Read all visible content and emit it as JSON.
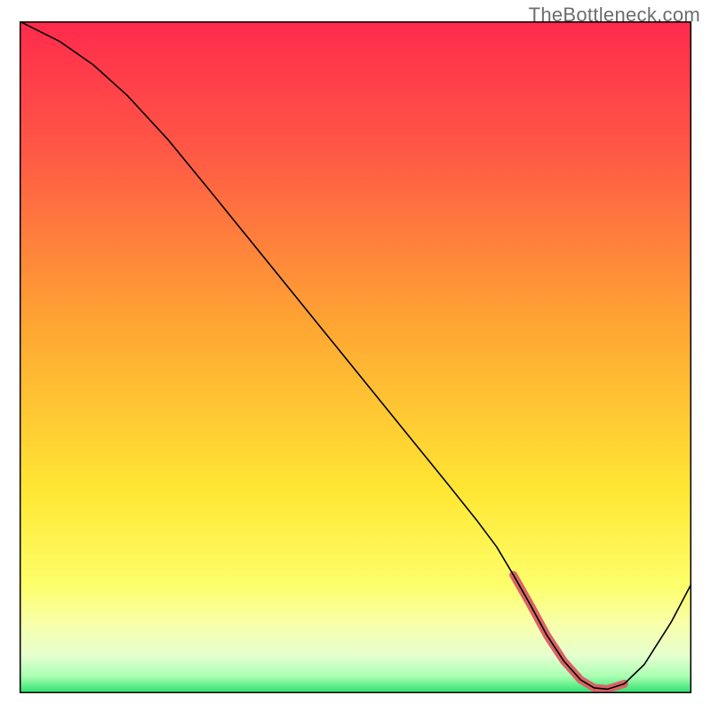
{
  "watermark": "TheBottleneck.com",
  "chart_data": {
    "type": "line",
    "title": "",
    "xlabel": "",
    "ylabel": "",
    "xlim": [
      0,
      100
    ],
    "ylim": [
      0,
      100
    ],
    "grid": false,
    "legend": false,
    "background_gradient": [
      {
        "pos": 0.0,
        "color": "#ff2a4d"
      },
      {
        "pos": 0.2,
        "color": "#ff5a45"
      },
      {
        "pos": 0.45,
        "color": "#ffa533"
      },
      {
        "pos": 0.7,
        "color": "#ffe733"
      },
      {
        "pos": 0.84,
        "color": "#fdff6b"
      },
      {
        "pos": 0.9,
        "color": "#f7ffad"
      },
      {
        "pos": 0.945,
        "color": "#e5ffcf"
      },
      {
        "pos": 0.975,
        "color": "#a9ffb2"
      },
      {
        "pos": 1.0,
        "color": "#27e06b"
      }
    ],
    "series": [
      {
        "name": "bottleneck-curve",
        "color": "#000000",
        "stroke_width": 1.6,
        "x": [
          0,
          6,
          11,
          16,
          22,
          28,
          34,
          40,
          46,
          52,
          58,
          64,
          68,
          71,
          73.5,
          76,
          78.5,
          81,
          83.5,
          85.5,
          87.5,
          90,
          93,
          97,
          100
        ],
        "y": [
          100,
          97,
          93.5,
          89,
          82.5,
          75.2,
          67.8,
          60.4,
          53,
          45.6,
          38.2,
          30.8,
          25.8,
          21.8,
          17.6,
          13.2,
          8.6,
          4.8,
          2.0,
          0.8,
          0.6,
          1.4,
          4.3,
          10.6,
          16.3
        ]
      }
    ],
    "highlight": {
      "name": "sweet-spot",
      "color": "#d96366",
      "stroke_width": 9,
      "linecap": "round",
      "x": [
        73.5,
        76,
        78.5,
        81,
        83.5,
        85.5,
        87.5,
        90
      ],
      "y": [
        17.6,
        13.2,
        8.6,
        4.8,
        2.0,
        0.8,
        0.6,
        1.4
      ]
    },
    "frame": {
      "color": "#000000",
      "width": 3
    }
  }
}
